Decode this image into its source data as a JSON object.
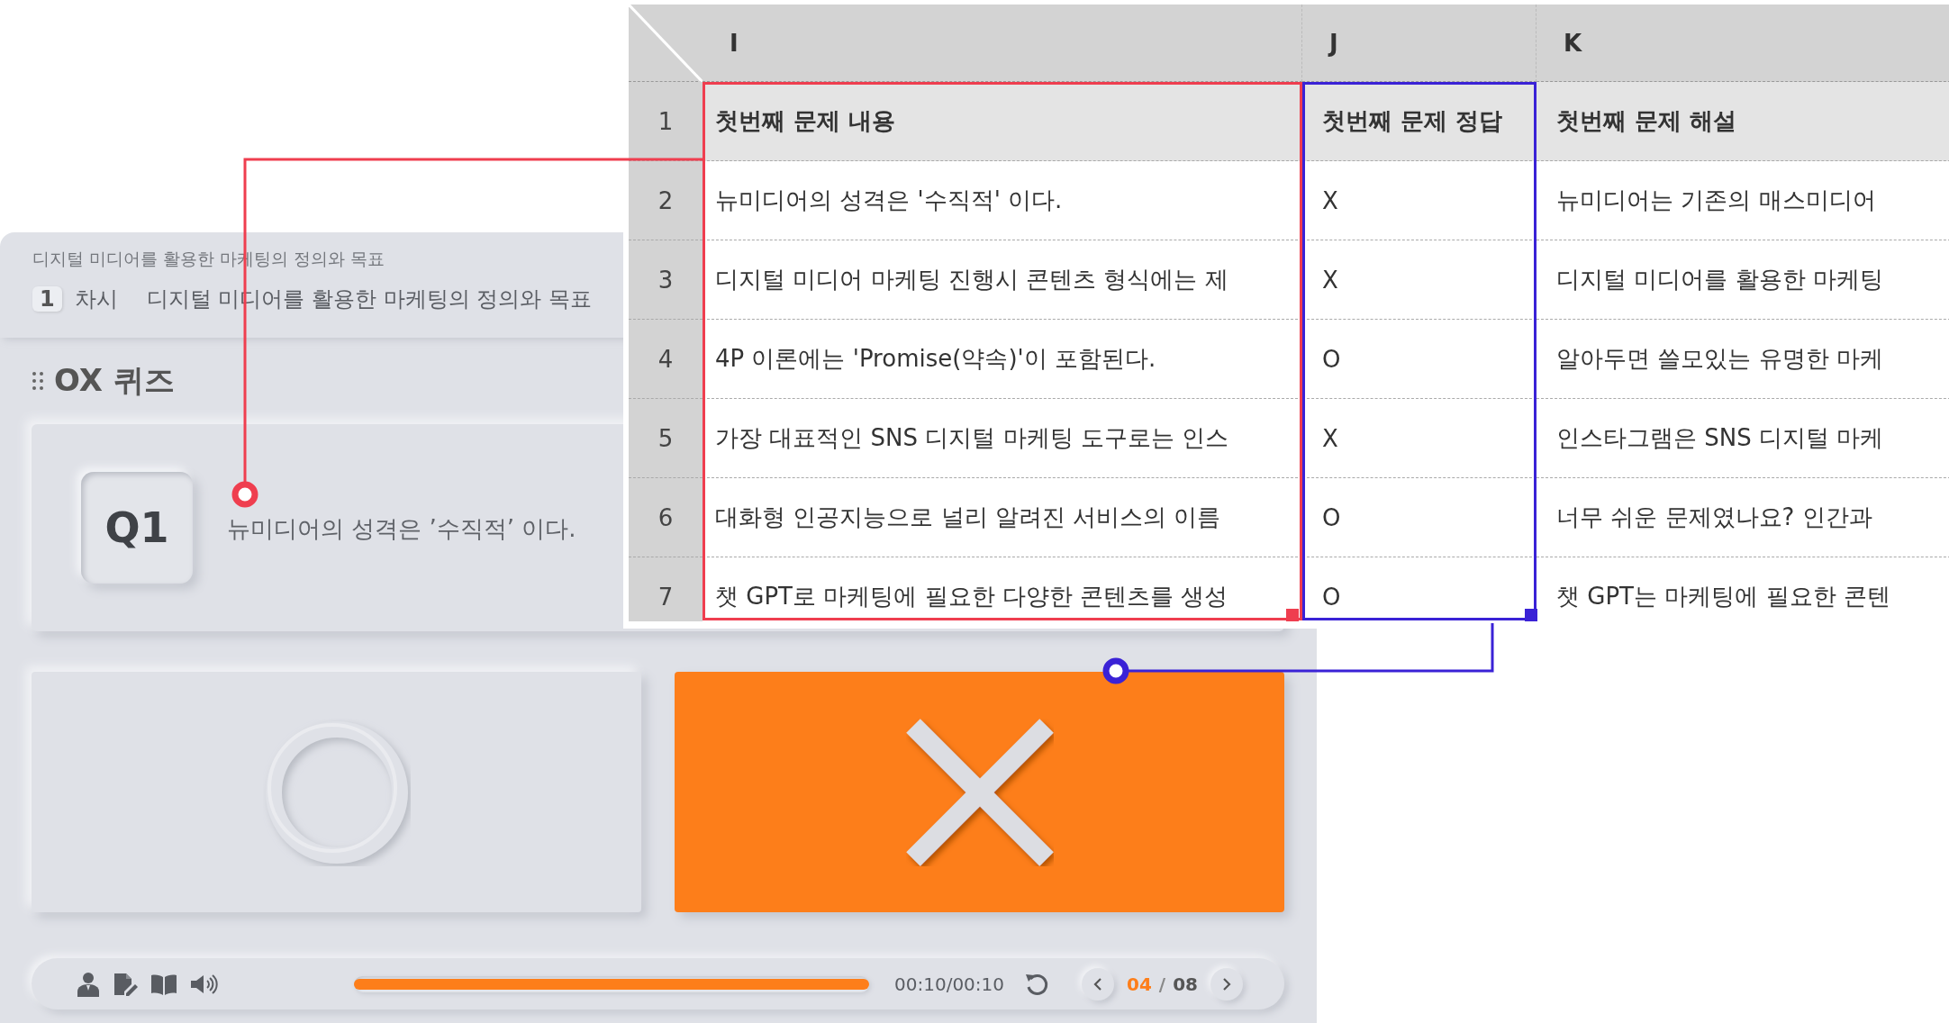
{
  "quiz": {
    "breadcrumb": "디지털 미디어를 활용한 마케팅의 정의와 목표",
    "session_number": "1",
    "session_label": "차시",
    "session_title": "디지털 미디어를 활용한 마케팅의 정의와 목표",
    "section_title": "OX 퀴즈",
    "question": {
      "number": "Q1",
      "text": "뉴미디어의 성격은 ’수직적’ 이다."
    },
    "answers": [
      {
        "kind": "o",
        "selected": false
      },
      {
        "kind": "x",
        "selected": true
      }
    ],
    "player": {
      "progress": {
        "level": 1.0
      },
      "time": "00:10/00:10",
      "page_current": "04",
      "page_separator": "/",
      "page_total": "08"
    }
  },
  "sheet": {
    "columns": [
      {
        "label": "I",
        "color": "#ef3e4f"
      },
      {
        "label": "J",
        "color": "#3a22d6"
      },
      {
        "label": "K"
      }
    ],
    "rows": [
      {
        "number": "1",
        "header": true,
        "cells": [
          "첫번째 문제 내용",
          "첫번째 문제 정답",
          "첫번째 문제 해설"
        ]
      },
      {
        "number": "2",
        "header": false,
        "cells": [
          "뉴미디어의 성격은 '수직적' 이다.",
          "X",
          "뉴미디어는 기존의 매스미디어"
        ]
      },
      {
        "number": "3",
        "header": false,
        "cells": [
          "디지털 미디어 마케팅 진행시 콘텐츠 형식에는 제",
          "X",
          "디지털 미디어를 활용한 마케팅"
        ]
      },
      {
        "number": "4",
        "header": false,
        "cells": [
          "4P 이론에는 'Promise(약속)'이 포함된다.",
          "O",
          "알아두면 쓸모있는 유명한 마케"
        ]
      },
      {
        "number": "5",
        "header": false,
        "cells": [
          "가장 대표적인 SNS 디지털 마케팅 도구로는 인스",
          "X",
          "인스타그램은 SNS 디지털 마케"
        ]
      },
      {
        "number": "6",
        "header": false,
        "cells": [
          "대화형 인공지능으로 널리 알려진 서비스의 이름",
          "O",
          "너무 쉬운 문제였나요? 인간과"
        ]
      },
      {
        "number": "7",
        "header": false,
        "cells": [
          "챗 GPT로 마케팅에 필요한 다양한 콘텐츠를 생성",
          "O",
          "챗 GPT는 마케팅에 필요한 콘텐"
        ]
      }
    ]
  }
}
